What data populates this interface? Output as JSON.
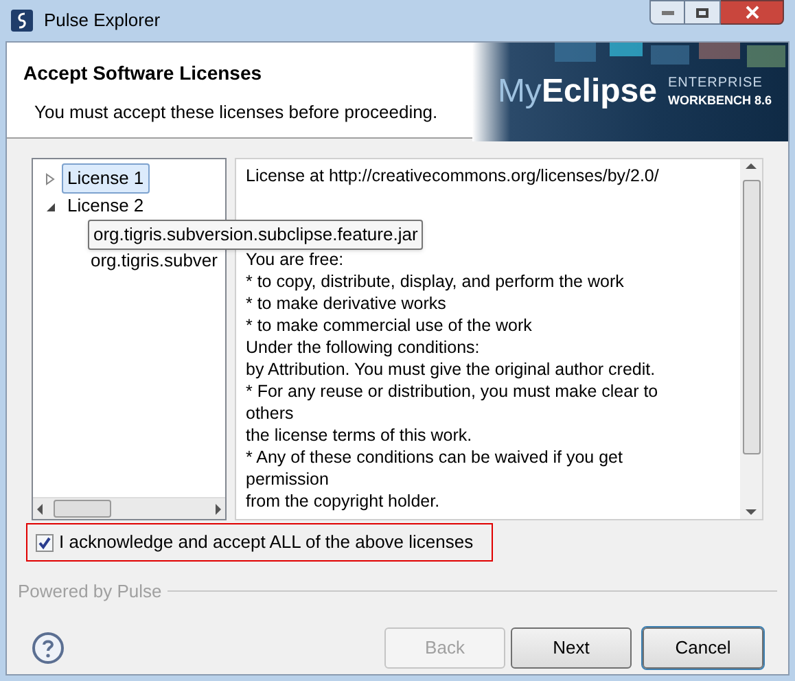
{
  "window": {
    "title": "Pulse Explorer"
  },
  "header": {
    "title": "Accept Software Licenses",
    "message": "You must accept these licenses before proceeding.",
    "banner": {
      "brand_light": "My",
      "brand_bold": "Eclipse",
      "edition": "ENTERPRISE",
      "product": "WORKBENCH 8.6"
    }
  },
  "tree": [
    {
      "label": "License 1",
      "selected": true,
      "expanded": false
    },
    {
      "label": "License 2",
      "selected": false,
      "expanded": true,
      "children": [
        {
          "label": "org.tigris.subversion.subclipse.feature.jar",
          "tooltip": true
        },
        {
          "label": "org.tigris.subver",
          "tooltip": false
        }
      ]
    }
  ],
  "license_text": [
    [
      "License at http://creativecommons.org/licenses/by/2.0/"
    ],
    [
      "You are free:",
      "* to copy, distribute, display, and perform the work",
      "* to make derivative works",
      "* to make commercial use of the work",
      "Under the following conditions:",
      "by Attribution. You must give the original author credit.",
      "* For any reuse or distribution, you must make clear to",
      "others",
      "the license terms of this work.",
      "* Any of these conditions can be waived if you get",
      "permission",
      "from the copyright holder."
    ]
  ],
  "accept": {
    "label": "I acknowledge and accept ALL of the above licenses",
    "checked": true
  },
  "footer": {
    "label": "Powered by Pulse"
  },
  "buttons": [
    {
      "label": "Back",
      "disabled": true,
      "focused": false
    },
    {
      "label": "Next",
      "disabled": false,
      "focused": false
    },
    {
      "label": "Cancel",
      "disabled": false,
      "focused": true
    }
  ]
}
